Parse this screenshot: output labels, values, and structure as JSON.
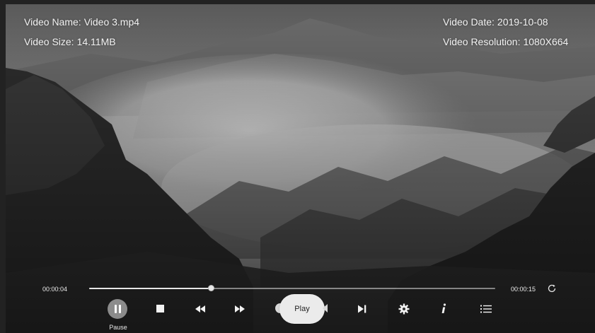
{
  "video_info": {
    "name_label": "Video Name:",
    "name_value": "Video 3.mp4",
    "size_label": "Video Size:",
    "size_value": "14.11MB",
    "date_label": "Video Date:",
    "date_value": "2019-10-08",
    "resolution_label": "Video Resolution:",
    "resolution_value": "1080X664"
  },
  "playback": {
    "current_time": "00:00:04",
    "total_time": "00:00:15",
    "progress": 0.3
  },
  "controls": {
    "pause_label": "Pause",
    "play_label": "Play",
    "buttons": [
      {
        "name": "pause",
        "icon": "pause-icon"
      },
      {
        "name": "stop",
        "icon": "stop-icon"
      },
      {
        "name": "rewind",
        "icon": "rewind-icon"
      },
      {
        "name": "fast-forward",
        "icon": "fast-forward-icon"
      },
      {
        "name": "play",
        "icon": "play-icon"
      },
      {
        "name": "next",
        "icon": "skip-next-icon"
      },
      {
        "name": "settings",
        "icon": "gear-icon"
      },
      {
        "name": "info",
        "icon": "info-icon"
      },
      {
        "name": "playlist",
        "icon": "list-icon"
      },
      {
        "name": "loop",
        "icon": "loop-icon"
      }
    ]
  },
  "colors": {
    "overlay_text": "#f2f2f2",
    "pill_bg": "#ebebeb",
    "track": "#e6e6e6"
  }
}
